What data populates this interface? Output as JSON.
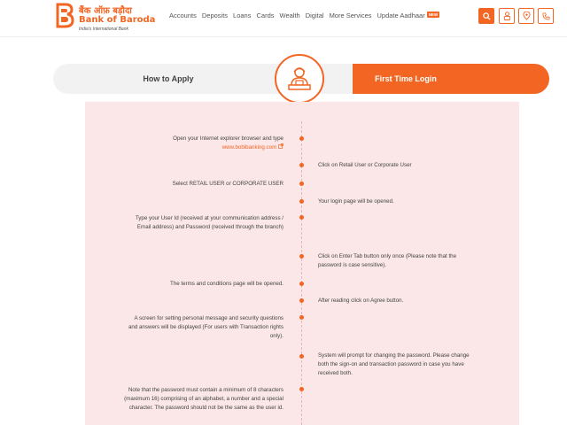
{
  "brand": {
    "hindi": "बैंक ऑफ़ बड़ौदा",
    "name": "Bank of Baroda",
    "tagline": "India's International Bank",
    "color": "#f26522"
  },
  "nav": {
    "items": [
      "Accounts",
      "Deposits",
      "Loans",
      "Cards",
      "Wealth",
      "Digital",
      "More Services",
      "Update Aadhaar"
    ],
    "new_badge": "NEW"
  },
  "header_icons": [
    "search-icon",
    "user-icon",
    "location-icon",
    "phone-icon"
  ],
  "tabs": {
    "left": "How to Apply",
    "right": "First Time Login",
    "center_icon": "agent-icon"
  },
  "steps": {
    "s1": "Open your Internet explorer browser and type",
    "s1_link": "www.bobibanking.com",
    "s2": "Click on Retail User or Corporate User",
    "s3": "Select RETAIL USER or CORPORATE USER",
    "s4": "Your login page will be opened.",
    "s5": "Type your User Id (received at your communication address / Email address) and Password (received through the branch)",
    "s6": "Click on Enter Tab button only once (Please note that the password is case sensitive).",
    "s7": "The terms and conditions page will be opened.",
    "s8": "After reading click on Agree button.",
    "s9": "A screen for setting personal message and security questions and answers will be displayed (For users with Transaction rights only).",
    "s10": "System will prompt for changing the password. Please change both the sign-on and transaction password in case you have received both.",
    "s11": "Note that the password must contain a minimum of 8 characters (maximum 16) comprising of an alphabet, a number and a special character. The password should not be the same as the user id."
  }
}
